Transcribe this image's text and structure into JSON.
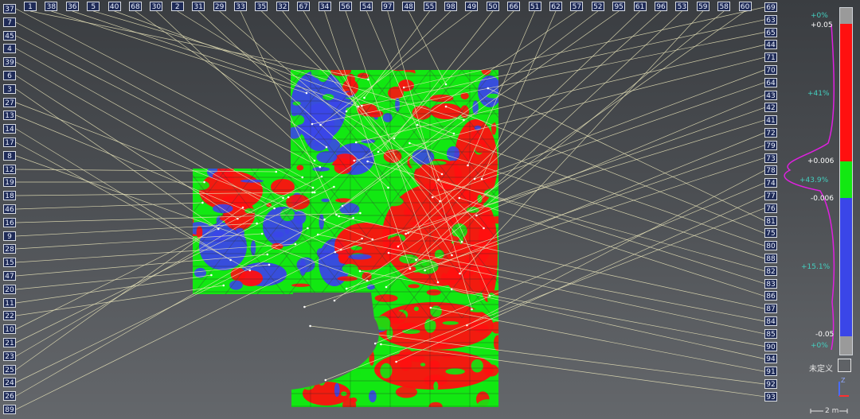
{
  "left_tags": [
    "37",
    "7",
    "45",
    "4",
    "39",
    "6",
    "3",
    "27",
    "13",
    "14",
    "17",
    "8",
    "12",
    "19",
    "18",
    "46",
    "16",
    "9",
    "28",
    "15",
    "47",
    "20",
    "11",
    "22",
    "10",
    "21",
    "23",
    "25",
    "24",
    "26",
    "89"
  ],
  "top_tags": [
    "1",
    "38",
    "36",
    "5",
    "40",
    "68",
    "30",
    "2",
    "31",
    "29",
    "33",
    "35",
    "32",
    "67",
    "34",
    "56",
    "54",
    "97",
    "48",
    "55",
    "98",
    "49",
    "50",
    "66",
    "51",
    "62",
    "57",
    "52",
    "95",
    "61",
    "96",
    "53",
    "59",
    "58",
    "60"
  ],
  "right_tags": [
    "69",
    "63",
    "65",
    "44",
    "71",
    "70",
    "64",
    "43",
    "42",
    "41",
    "72",
    "79",
    "73",
    "78",
    "74",
    "77",
    "76",
    "81",
    "75",
    "80",
    "88",
    "82",
    "83",
    "86",
    "87",
    "84",
    "85",
    "90",
    "94",
    "91",
    "92",
    "93"
  ],
  "colors": {
    "red": "#ff1010",
    "green": "#12e812",
    "blue": "#3a46e8",
    "gray": "#9a9a9a",
    "leader": "#e9e4b8",
    "tag_bg": "#1f2b57"
  },
  "legend": {
    "labels": [
      {
        "text": "+0%",
        "kind": "pct"
      },
      {
        "text": "+0.05",
        "kind": "val"
      },
      {
        "text": "+41%",
        "kind": "pct"
      },
      {
        "text": "+0.006",
        "kind": "val"
      },
      {
        "text": "+43.9%",
        "kind": "pct"
      },
      {
        "text": "-0.006",
        "kind": "val"
      },
      {
        "text": "+15.1%",
        "kind": "pct"
      },
      {
        "text": "-0.05",
        "kind": "val"
      },
      {
        "text": "+0%",
        "kind": "pct"
      }
    ],
    "undefined_label": "未定义",
    "scale_label": "2 m",
    "axis_label": "Z"
  }
}
